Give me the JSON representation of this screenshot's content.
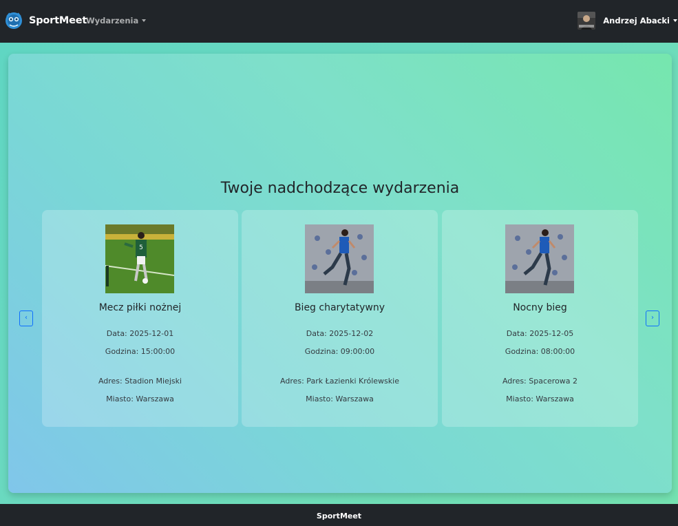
{
  "navbar": {
    "brand_name": "SportMeet",
    "menu_label": "Wydarzenia",
    "user_name": "Andrzej Abacki"
  },
  "main": {
    "title": "Twoje nadchodzące wydarzenia",
    "prev_icon": "chevron-left-icon",
    "next_icon": "chevron-right-icon",
    "prev_glyph": "‹",
    "next_glyph": "›",
    "events": [
      {
        "title": "Mecz piłki nożnej",
        "date": "Data: 2025-12-01",
        "time": "Godzina: 15:00:00",
        "address": "Adres: Stadion Miejski",
        "city": "Miasto: Warszawa"
      },
      {
        "title": "Bieg charytatywny",
        "date": "Data: 2025-12-02",
        "time": "Godzina: 09:00:00",
        "address": "Adres: Park Łazienki Królewskie",
        "city": "Miasto: Warszawa"
      },
      {
        "title": "Nocny bieg",
        "date": "Data: 2025-12-05",
        "time": "Godzina: 08:00:00",
        "address": "Adres: Spacerowa 2",
        "city": "Miasto: Warszawa"
      }
    ]
  },
  "footer": {
    "text": "SportMeet"
  },
  "colors": {
    "navbar_bg": "#212529",
    "accent": "#0d6efd"
  }
}
